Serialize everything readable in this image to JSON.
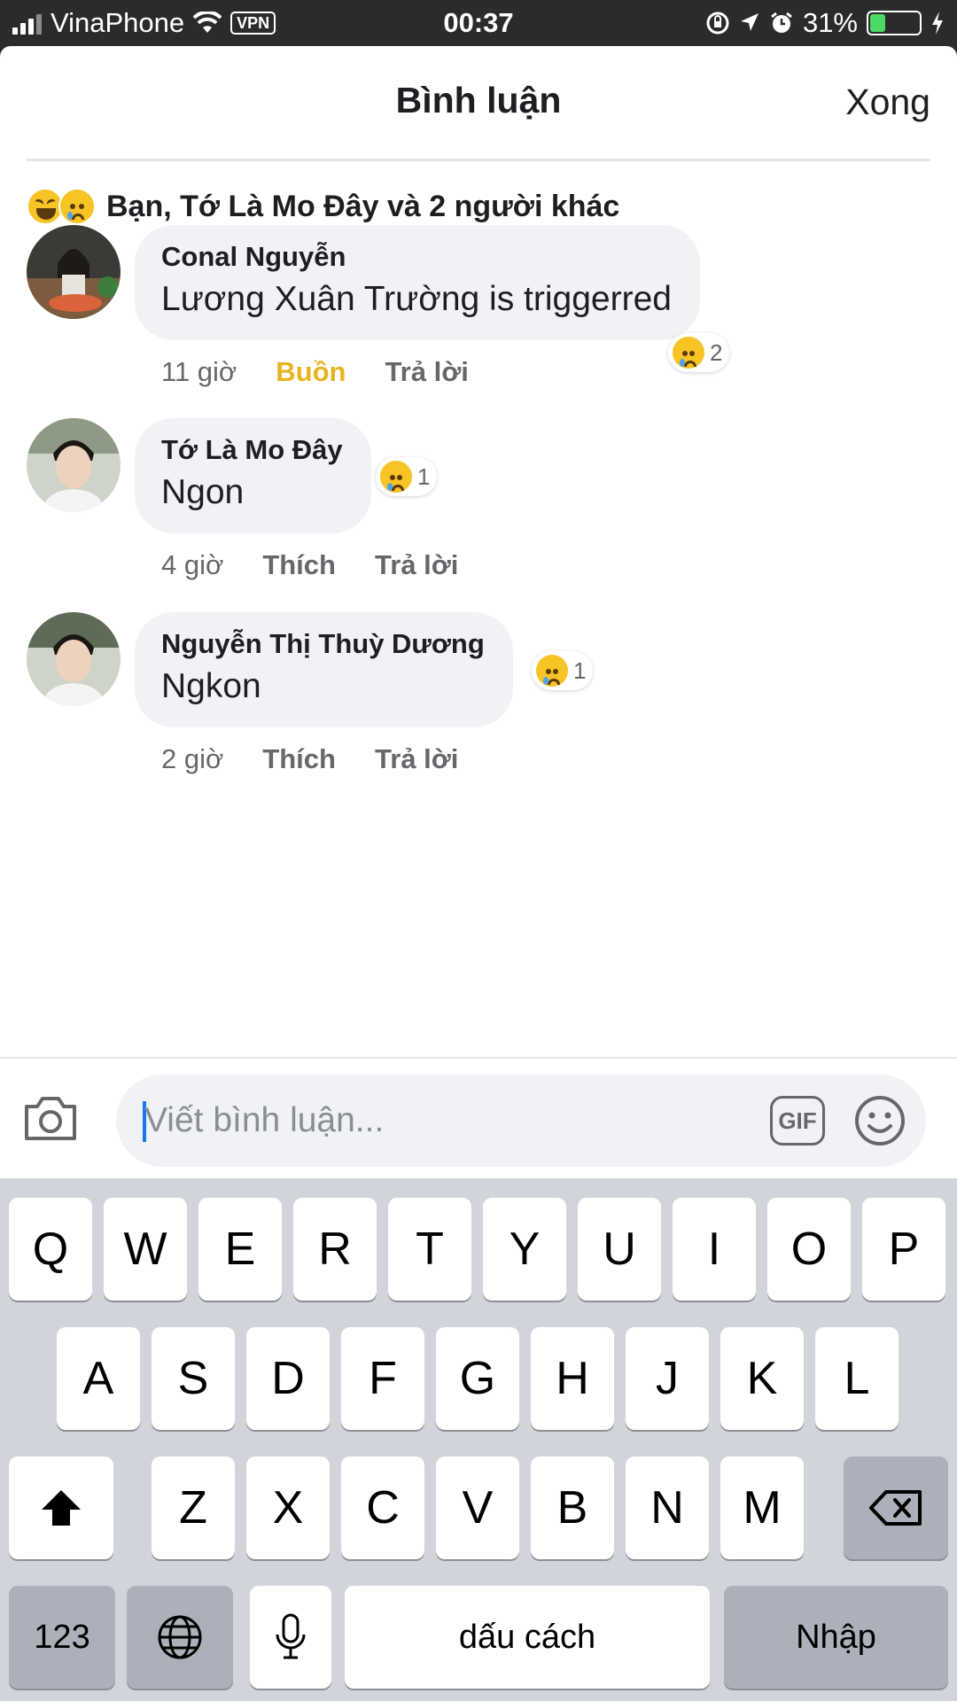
{
  "status_bar": {
    "carrier": "VinaPhone",
    "vpn": "VPN",
    "time": "00:37",
    "battery": "31%",
    "battery_level": 0.31,
    "battery_color": "#4cd964"
  },
  "header": {
    "title": "Bình luận",
    "done_label": "Xong"
  },
  "reactions_summary": {
    "icons": [
      "haha-icon",
      "sad-icon"
    ],
    "text": "Bạn, Tớ Là Mo Đây và 2 người khác"
  },
  "comments": [
    {
      "author": "Conal Nguyễn",
      "text": "Lương Xuân Trường is triggerred",
      "time": "11 giờ",
      "reaction_label": "Buồn",
      "reply_label": "Trả lời",
      "reaction_count": "2"
    },
    {
      "author": "Tớ Là Mo Đây",
      "text": "Ngon",
      "time": "4 giờ",
      "reaction_label": "Thích",
      "reply_label": "Trả lời",
      "reaction_count": "1"
    },
    {
      "author": "Nguyễn Thị Thuỳ Dương",
      "text": "Ngkon",
      "time": "2 giờ",
      "reaction_label": "Thích",
      "reply_label": "Trả lời",
      "reaction_count": "1"
    }
  ],
  "composer": {
    "placeholder": "Viết bình luận...",
    "gif_label": "GIF"
  },
  "keyboard": {
    "row1": [
      "Q",
      "W",
      "E",
      "R",
      "T",
      "Y",
      "U",
      "I",
      "O",
      "P"
    ],
    "row2": [
      "A",
      "S",
      "D",
      "F",
      "G",
      "H",
      "J",
      "K",
      "L"
    ],
    "row3": [
      "Z",
      "X",
      "C",
      "V",
      "B",
      "N",
      "M"
    ],
    "numbers_label": "123",
    "space_label": "dấu cách",
    "return_label": "Nhập"
  },
  "colors": {
    "accent_active": "#e8b321",
    "bubble_bg": "#f0f2f5",
    "keyboard_bg": "#d1d5db",
    "caret": "#1877f2"
  }
}
